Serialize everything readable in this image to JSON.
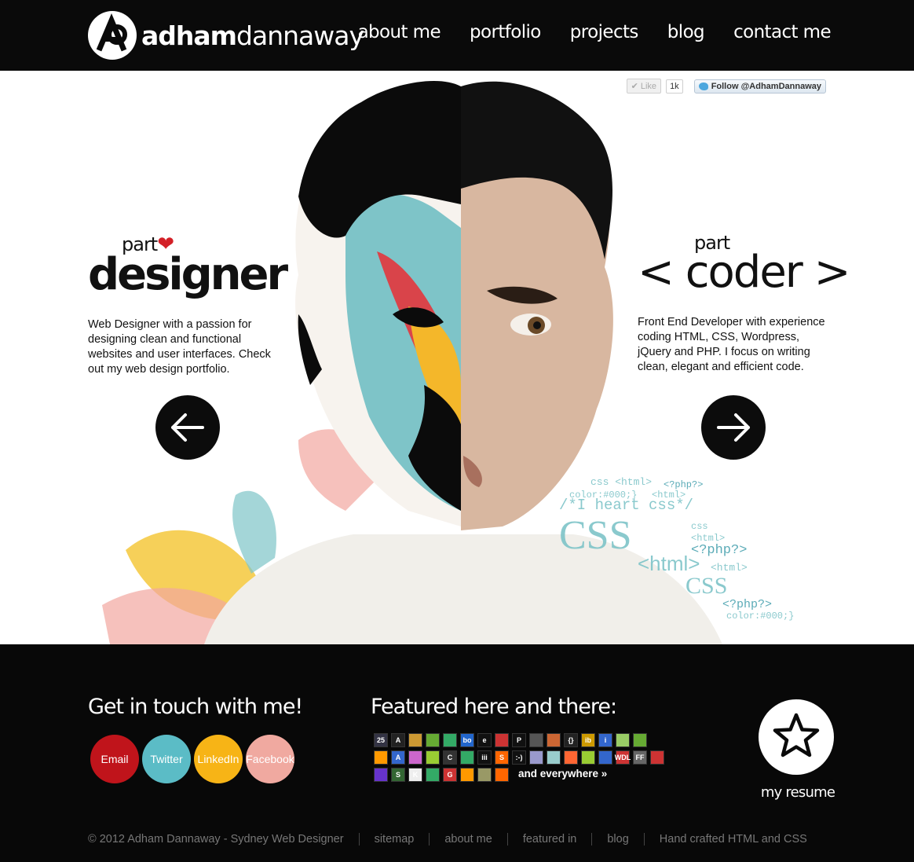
{
  "header": {
    "logo_bold": "adham",
    "logo_light": "dannaway",
    "nav": [
      "about me",
      "portfolio",
      "projects",
      "blog",
      "contact me"
    ]
  },
  "social": {
    "like_label": "Like",
    "like_count": "1k",
    "follow_label": "Follow @AdhamDannaway"
  },
  "left": {
    "part": "part",
    "title": "designer",
    "description": "Web Designer with a passion for designing clean and functional websites and user interfaces. Check out my web design portfolio."
  },
  "right": {
    "part": "part",
    "title": "< coder >",
    "description": "Front End Developer with experience coding HTML, CSS, Wordpress, jQuery and PHP. I focus on writing clean, elegant and efficient code."
  },
  "code_words": [
    "css <html>",
    "<?php?>",
    "color:#000;}",
    "<html>",
    "/*I heart css*/",
    "CSS",
    "css",
    "<html>",
    "<?php?>",
    "<html>",
    "<html>",
    "CSS",
    "<?php?>",
    "color:#000;}"
  ],
  "contact": {
    "heading": "Get in touch with me!",
    "buttons": [
      {
        "label": "Email",
        "color": "#c0141b"
      },
      {
        "label": "Twitter",
        "color": "#5bbcc6"
      },
      {
        "label": "LinkedIn",
        "color": "#f7b416"
      },
      {
        "label": "Facebook",
        "color": "#f0a9a0"
      }
    ]
  },
  "featured": {
    "heading": "Featured here and there:",
    "rows": [
      [
        {
          "t": "25",
          "c": "#334"
        },
        {
          "t": "A",
          "c": "#222"
        },
        {
          "t": "",
          "c": "#c93"
        },
        {
          "t": "",
          "c": "#6a3"
        },
        {
          "t": "",
          "c": "#3a6"
        },
        {
          "t": "bo",
          "c": "#26c"
        },
        {
          "t": "e",
          "c": "#111"
        },
        {
          "t": "",
          "c": "#c33"
        },
        {
          "t": "P",
          "c": "#111"
        },
        {
          "t": "",
          "c": "#555"
        },
        {
          "t": "",
          "c": "#c63"
        },
        {
          "t": "{}",
          "c": "#222"
        },
        {
          "t": "ib",
          "c": "#c90"
        },
        {
          "t": "i",
          "c": "#36c"
        },
        {
          "t": "",
          "c": "#9c6"
        },
        {
          "t": "",
          "c": "#6a3"
        }
      ],
      [
        {
          "t": "",
          "c": "#f90"
        },
        {
          "t": "A",
          "c": "#36c"
        },
        {
          "t": "",
          "c": "#c6c"
        },
        {
          "t": "",
          "c": "#9c3"
        },
        {
          "t": "C",
          "c": "#333"
        },
        {
          "t": "",
          "c": "#3a6"
        },
        {
          "t": "iii",
          "c": "#111"
        },
        {
          "t": "S",
          "c": "#f60"
        },
        {
          "t": ":-)",
          "c": "#111"
        },
        {
          "t": "",
          "c": "#99c"
        },
        {
          "t": "",
          "c": "#9cc"
        },
        {
          "t": "",
          "c": "#f63"
        },
        {
          "t": "",
          "c": "#9c3"
        },
        {
          "t": "",
          "c": "#36c"
        },
        {
          "t": "WDL",
          "c": "#c33"
        },
        {
          "t": "FF",
          "c": "#666"
        },
        {
          "t": "",
          "c": "#c33"
        }
      ],
      [
        {
          "t": "",
          "c": "#63c"
        },
        {
          "t": "S",
          "c": "#363"
        },
        {
          "t": "K",
          "c": "#eee"
        },
        {
          "t": "",
          "c": "#3a6"
        },
        {
          "t": "G",
          "c": "#c33"
        },
        {
          "t": "",
          "c": "#f90"
        },
        {
          "t": "",
          "c": "#996"
        },
        {
          "t": "",
          "c": "#f60"
        }
      ]
    ],
    "more": "and everywhere »"
  },
  "resume": {
    "label": "my resume"
  },
  "bottom": [
    "© 2012 Adham Dannaway - Sydney Web Designer",
    "sitemap",
    "about me",
    "featured in",
    "blog",
    "Hand crafted HTML and CSS"
  ]
}
